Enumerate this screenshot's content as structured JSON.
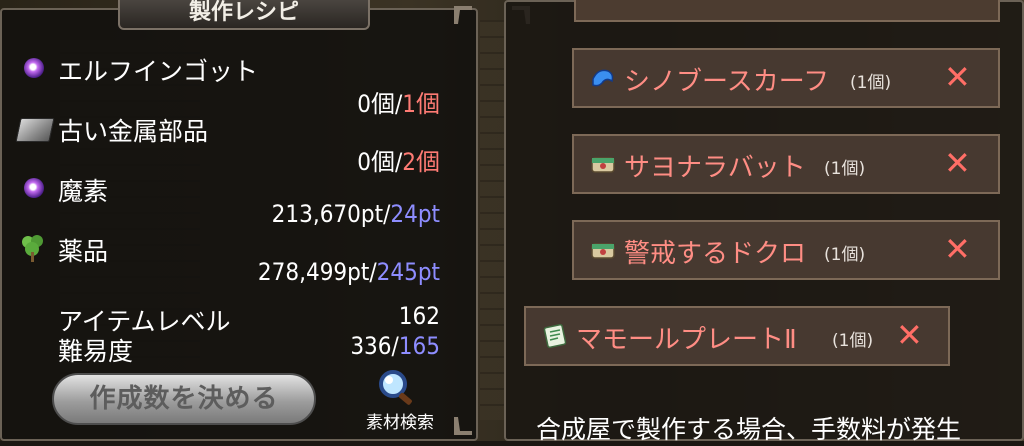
{
  "recipe_panel": {
    "title": "製作レシピ",
    "materials": [
      {
        "icon": "purple-orb-icon",
        "name": "エルフインゴット",
        "have": "0個",
        "sep": "/",
        "need": "1個",
        "need_color": "#ff7b74"
      },
      {
        "icon": "metal-ingot-icon",
        "name": "古い金属部品",
        "have": "0個",
        "sep": "/",
        "need": "2個",
        "need_color": "#ff7b74"
      },
      {
        "icon": "purple-orb-icon",
        "name": "魔素",
        "have": "213,670pt",
        "sep": "/",
        "need": "24pt",
        "need_color": "#8e8dff"
      },
      {
        "icon": "herb-icon",
        "name": "薬品",
        "have": "278,499pt",
        "sep": "/",
        "need": "245pt",
        "need_color": "#8e8dff"
      }
    ],
    "item_level_label": "アイテムレベル",
    "item_level_value": "162",
    "difficulty_label": "難易度",
    "difficulty_have": "336",
    "difficulty_sep": "/",
    "difficulty_need": "165",
    "make_button": "作成数を決める",
    "search_label": "素材検索"
  },
  "queue_panel": {
    "items": [
      {
        "icon": "blue-scarf-icon",
        "name": "シノブースカーフ",
        "count": "(1個)"
      },
      {
        "icon": "box-icon",
        "name": "サヨナラバット",
        "count": "(1個)"
      },
      {
        "icon": "box-icon",
        "name": "警戒するドクロ",
        "count": "(1個)"
      },
      {
        "icon": "scroll-icon",
        "name": "マモールプレートⅡ",
        "count": "(1個)"
      }
    ],
    "remove_symbol": "✕",
    "footer": "合成屋で製作する場合、手数料が発生"
  },
  "colors": {
    "accent_red": "#ff7b74",
    "accent_blue": "#8e8dff",
    "item_text": "#ff8d84"
  }
}
